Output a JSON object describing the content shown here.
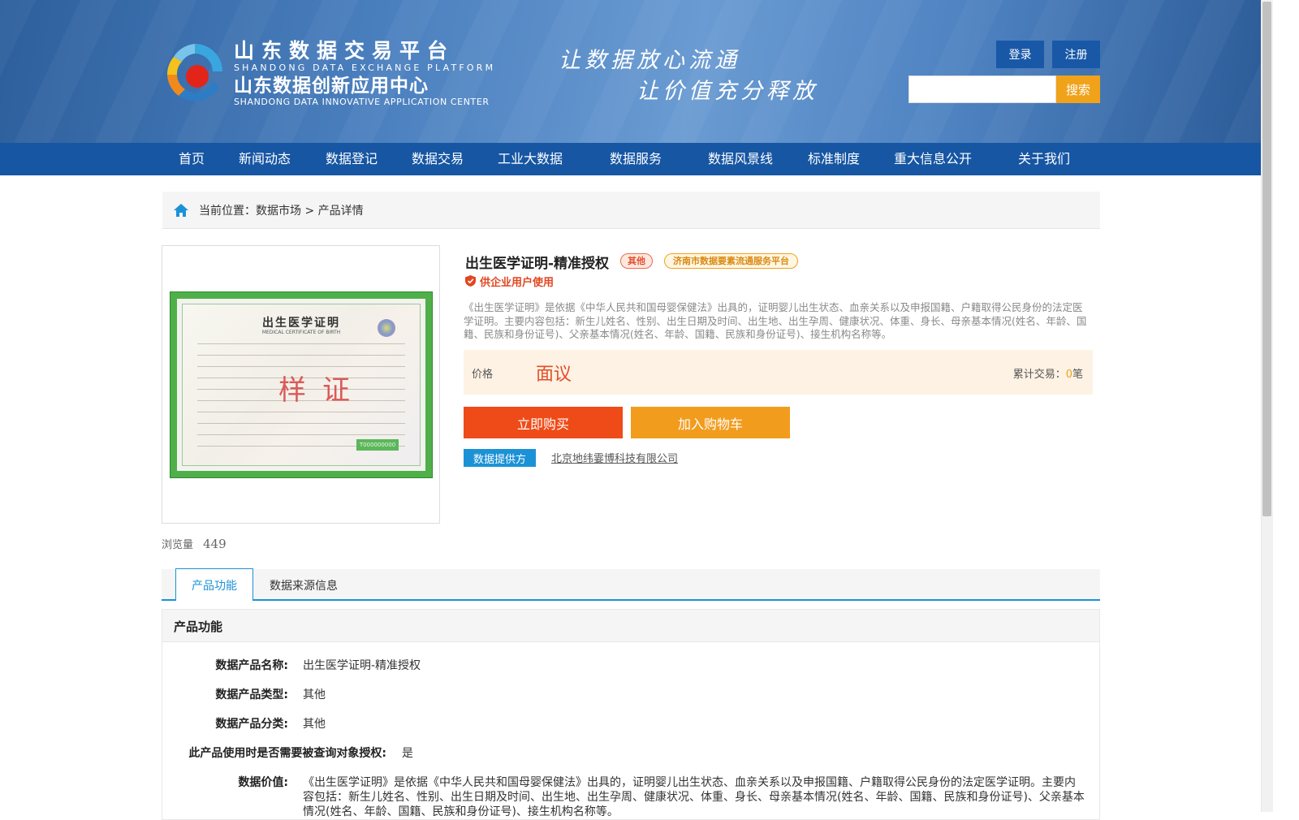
{
  "header": {
    "logo_cn1": "山东数据交易平台",
    "logo_en1": "SHANDONG DATA EXCHANGE PLATFORM",
    "logo_cn2": "山东数据创新应用中心",
    "logo_en2": "SHANDONG DATA INNOVATIVE APPLICATION CENTER",
    "slogan_line1": "让数据放心流通",
    "slogan_line2": "让价值充分释放",
    "login_label": "登录",
    "register_label": "注册",
    "search_value": "",
    "search_label": "搜索"
  },
  "nav": [
    "首页",
    "新闻动态",
    "数据登记",
    "数据交易",
    "工业大数据",
    "数据服务",
    "数据风景线",
    "标准制度",
    "重大信息公开",
    "关于我们"
  ],
  "breadcrumb": {
    "prefix": "当前位置：",
    "market": "数据市场",
    "sep": " > ",
    "current": "产品详情"
  },
  "product": {
    "image": {
      "title": "出生医学证明",
      "subtitle": "MEDICAL CERTIFICATE OF BIRTH",
      "stamp": "样证",
      "code": "T000000000"
    },
    "title": "出生医学证明-精准授权",
    "tag_type": "其他",
    "tag_platform": "济南市数据要素流通服务平台",
    "audience": "供企业用户使用",
    "description": "《出生医学证明》是依据《中华人民共和国母婴保健法》出具的，证明婴儿出生状态、血亲关系以及申报国籍、户籍取得公民身份的法定医学证明。主要内容包括：新生儿姓名、性别、出生日期及时间、出生地、出生孕周、健康状况、体重、身长、母亲基本情况(姓名、年龄、国籍、民族和身份证号)、父亲基本情况(姓名、年龄、国籍、民族和身份证号)、接生机构名称等。",
    "price_label": "价格",
    "price_value": "面议",
    "trade_prefix": "累计交易：",
    "trade_count": "0",
    "trade_unit": "笔",
    "buy_label": "立即购买",
    "cart_label": "加入购物车",
    "provider_label": "数据提供方",
    "provider_name": "北京地纬霎博科技有限公司",
    "views_label": "浏览量",
    "views_count": "449"
  },
  "tabs": {
    "function": "产品功能",
    "source": "数据来源信息"
  },
  "detail": {
    "heading": "产品功能",
    "rows": [
      {
        "key": "数据产品名称:",
        "value": "出生医学证明-精准授权"
      },
      {
        "key": "数据产品类型:",
        "value": "其他"
      },
      {
        "key": "数据产品分类:",
        "value": "其他"
      },
      {
        "key": "此产品使用时是否需要被查询对象授权:",
        "value": "是"
      },
      {
        "key": "数据价值:",
        "value": "《出生医学证明》是依据《中华人民共和国母婴保健法》出具的，证明婴儿出生状态、血亲关系以及申报国籍、户籍取得公民身份的法定医学证明。主要内容包括：新生儿姓名、性别、出生日期及时间、出生地、出生孕周、健康状况、体重、身长、母亲基本情况(姓名、年龄、国籍、民族和身份证号)、父亲基本情况(姓名、年龄、国籍、民族和身份证号)、接生机构名称等。"
      }
    ]
  },
  "colors": {
    "nav_blue": "#1656a3",
    "accent_orange": "#f0a21a",
    "buy_red": "#ef4b18",
    "tab_blue": "#1c92d6"
  }
}
